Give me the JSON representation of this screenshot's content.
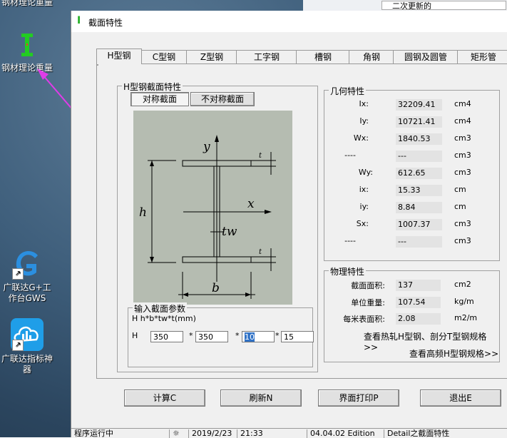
{
  "desktop": {
    "top_partial_label": "钢材理论重量",
    "icons": [
      {
        "label_lines": [
          "钢材理论重量"
        ]
      },
      {
        "label_lines": [
          "广联达G+工",
          "作台GWS"
        ]
      },
      {
        "label_lines": [
          "广联达指标神",
          "器"
        ]
      }
    ],
    "colors": {
      "arrow": "#e03ce8",
      "icon_green": "#22cc22"
    }
  },
  "background_window": {
    "text": "二次更新的"
  },
  "window": {
    "title": "截面特性",
    "title_icon": "I",
    "tabs": [
      "H型钢",
      "C型钢",
      "Z型钢",
      "工字钢",
      "槽钢",
      "角钢",
      "圆钢及圆管",
      "矩形管"
    ],
    "active_tab": "H型钢",
    "section_group": {
      "label": "H型钢截面特性",
      "buttons": {
        "symmetric": "对称截面",
        "asymmetric": "不对称截面"
      },
      "diagram_labels": {
        "y": "y",
        "x": "x",
        "h": "h",
        "b": "b",
        "tw": "tw",
        "t_top": "t",
        "t_bottom": "t"
      }
    },
    "input_group": {
      "label": "输入截面参数",
      "formula": "H   h*b*tw*t(mm)",
      "row_label": "H",
      "separator": "*",
      "values": [
        "350",
        "350",
        "10",
        "15"
      ]
    },
    "geometry": {
      "label": "几何特性",
      "rows": [
        {
          "name": "Ix:",
          "value": "32209.41",
          "unit": "cm4"
        },
        {
          "name": "Iy:",
          "value": "10721.41",
          "unit": "cm4"
        },
        {
          "name": "Wx:",
          "value": "1840.53",
          "unit": "cm3"
        },
        {
          "name": "----",
          "value": "---",
          "unit": "cm3"
        },
        {
          "name": "Wy:",
          "value": "612.65",
          "unit": "cm3"
        },
        {
          "name": "ix:",
          "value": "15.33",
          "unit": "cm"
        },
        {
          "name": "iy:",
          "value": "8.84",
          "unit": "cm"
        },
        {
          "name": "Sx:",
          "value": "1007.37",
          "unit": "cm3"
        },
        {
          "name": "----",
          "value": "---",
          "unit": "cm3"
        }
      ]
    },
    "physical": {
      "label": "物理特性",
      "rows": [
        {
          "name": "截面面积:",
          "value": "137",
          "unit": "cm2"
        },
        {
          "name": "单位重量:",
          "value": "107.54",
          "unit": "kg/m"
        },
        {
          "name": "每米表面积:",
          "value": "2.08",
          "unit": "m2/m"
        }
      ],
      "links": [
        "查看热轧H型钢、剖分T型钢规格>>",
        "查看高频H型钢规格>>"
      ]
    },
    "buttons": {
      "calc": "计算C",
      "refresh": "刷新N",
      "print": "界面打印P",
      "exit": "退出E"
    },
    "status": {
      "state": "程序运行中",
      "date": "2019/2/23",
      "time": "21:33",
      "edition": "04.04.02 Edition",
      "module": "Detail之截面特性"
    }
  }
}
